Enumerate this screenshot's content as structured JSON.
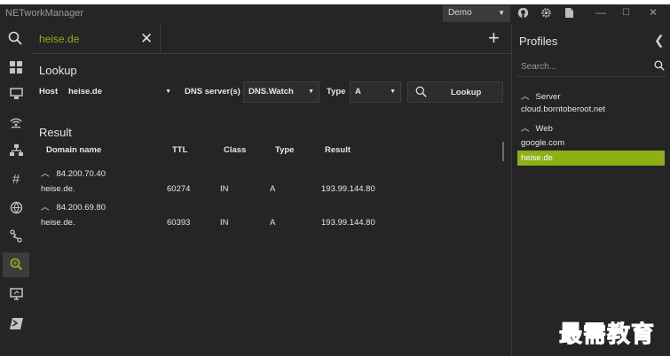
{
  "app": {
    "title": "NETworkManager",
    "profile": "Demo"
  },
  "search_tab": {
    "value": "heise.de"
  },
  "lookup": {
    "title": "Lookup",
    "host_label": "Host",
    "host_value": "heise.de",
    "dns_label": "DNS server(s)",
    "dns_value": "DNS.Watch",
    "type_label": "Type",
    "type_value": "A",
    "button_label": "Lookup"
  },
  "result": {
    "title": "Result",
    "columns": [
      "Domain name",
      "TTL",
      "Class",
      "Type",
      "Result"
    ],
    "groups": [
      {
        "header": "84.200.70.40",
        "rows": [
          {
            "domain": "heise.de.",
            "ttl": "60274",
            "class": "IN",
            "type": "A",
            "result": "193.99.144.80"
          }
        ]
      },
      {
        "header": "84.200.69.80",
        "rows": [
          {
            "domain": "heise.de.",
            "ttl": "60393",
            "class": "IN",
            "type": "A",
            "result": "193.99.144.80"
          }
        ]
      }
    ]
  },
  "profiles": {
    "title": "Profiles",
    "search_placeholder": "Search...",
    "groups": [
      {
        "name": "Server",
        "items": [
          "cloud.borntoberoot.net"
        ]
      },
      {
        "name": "Web",
        "items": [
          "google.com",
          "heise.de"
        ]
      }
    ],
    "selected": "heise.de"
  },
  "nav_icons": [
    "dashboard-icon",
    "network-interface-icon",
    "wifi-icon",
    "ip-scanner-icon",
    "port-scanner-icon",
    "ping-icon",
    "traceroute-icon",
    "dns-lookup-icon",
    "remote-desktop-icon",
    "powershell-icon"
  ],
  "colors": {
    "accent": "#8cb016",
    "background": "#252526",
    "watermark": "#1e1aa8"
  },
  "watermark": "最需教育"
}
